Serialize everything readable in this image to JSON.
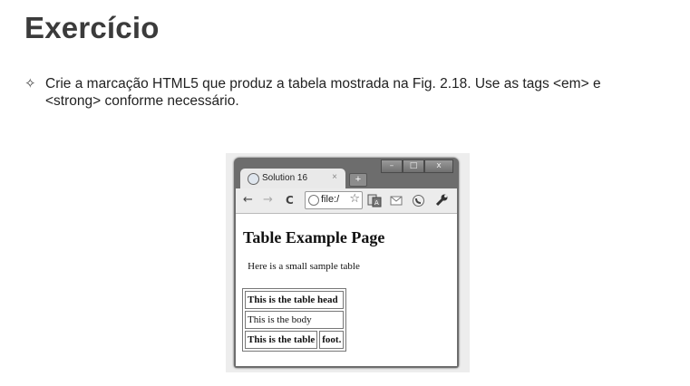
{
  "slide": {
    "title": "Exercício",
    "bullet_mark": "✧",
    "bullet_text": "Crie a marcação HTML5 que produz a tabela mostrada na Fig. 2.18. Use as tags <em> e <strong> conforme necessário."
  },
  "browser": {
    "window_controls": {
      "minimize": "–",
      "maximize": "□",
      "close": "x"
    },
    "tab": {
      "title": "Solution 16",
      "close": "×",
      "icon": "globe-icon"
    },
    "new_tab": "+",
    "toolbar": {
      "back": "←",
      "forward": "→",
      "reload": "C",
      "address": "file:/",
      "bookmark_star": "☆",
      "icons": [
        "translate-icon",
        "mail-icon",
        "phone-icon",
        "wrench-icon"
      ]
    },
    "page": {
      "heading": "Table Example Page",
      "caption": "Here is a small sample table",
      "table_head": "This is the table head",
      "table_body": "This is the body",
      "table_foot": [
        "This is the table",
        "foot."
      ]
    }
  }
}
